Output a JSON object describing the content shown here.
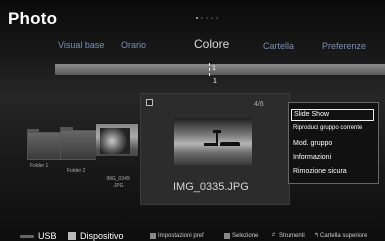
{
  "header": {
    "title": "Photo",
    "page_dots": 5,
    "active_page": 1
  },
  "tabs": [
    {
      "label": "Visual base",
      "active": false
    },
    {
      "label": "Orario",
      "active": false
    },
    {
      "label": "Colore",
      "active": true
    },
    {
      "label": "Cartella",
      "active": false
    },
    {
      "label": "Preferenze",
      "active": false
    }
  ],
  "timeline": {
    "marker_label_top": "1",
    "marker_label_bottom": "1"
  },
  "items": {
    "folder1": "Folder 1",
    "folder2": "Folder 2",
    "thumb_left": "IMG_0349 .JPG"
  },
  "preview": {
    "count": "4/6",
    "filename": "IMG_0335.JPG"
  },
  "menu": {
    "items": [
      "Slide Show",
      "Riproduci gruppo corrente",
      "Mod. gruppo",
      "Informazioni",
      "Rimozione sicura"
    ],
    "selected_index": 0
  },
  "statusbar": {
    "usb": "USB",
    "device": "Dispositivo",
    "keys": [
      {
        "label": "Impostazioni pref",
        "icon": "square-key-icon"
      },
      {
        "label": "Selezione",
        "icon": "square-key-icon"
      },
      {
        "label": "Strumenti",
        "icon": "tools-icon"
      },
      {
        "label": "Cartella superiore",
        "icon": "return-icon"
      }
    ]
  },
  "colors": {
    "background": "#000000",
    "tab_inactive": "#7a8fb5",
    "tab_active": "#d9d9d9",
    "menu_border": "#666666",
    "timeline": "#7a7a7a"
  }
}
